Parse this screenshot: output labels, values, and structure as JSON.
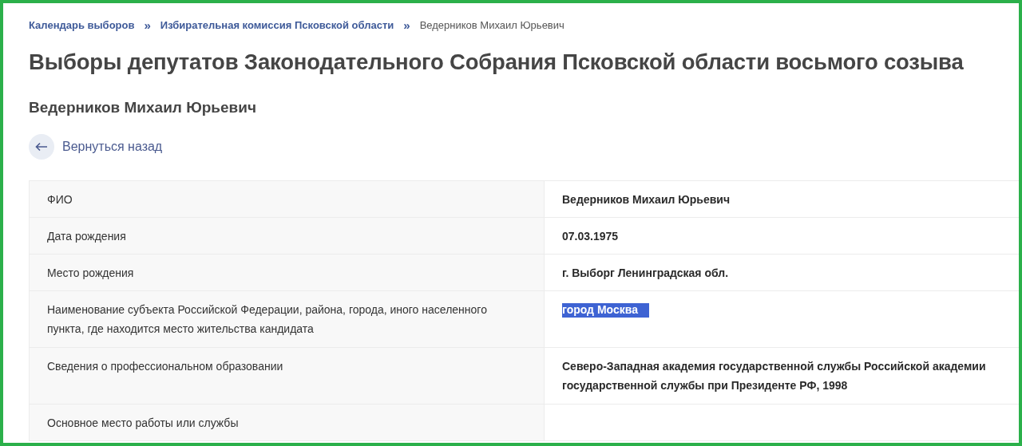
{
  "breadcrumbs": [
    {
      "label": "Календарь выборов",
      "kind": "link",
      "separator": "»"
    },
    {
      "label": "Избирательная комиссия Псковской области",
      "kind": "link",
      "separator": "»"
    },
    {
      "label": "Ведерников Михаил Юрьевич",
      "kind": "current"
    }
  ],
  "title": "Выборы депутатов Законодательного Собрания Псковской области восьмого созыва",
  "subtitle": "Ведерников Михаил Юрьевич",
  "back_link": {
    "label": "Вернуться назад"
  },
  "table": {
    "rows": [
      {
        "label": "ФИО",
        "value": "Ведерников Михаил Юрьевич",
        "highlighted": false
      },
      {
        "label": "Дата рождения",
        "value": "07.03.1975",
        "highlighted": false
      },
      {
        "label": "Место рождения",
        "value": "г. Выборг Ленинградская обл.",
        "highlighted": false
      },
      {
        "label": "Наименование субъекта Российской Федерации, района, города, иного населенного пункта, где находится место жительства кандидата",
        "value": "город Москва",
        "highlighted": true
      },
      {
        "label": "Сведения о профессиональном образовании",
        "value": "Северо-Западная академия государственной службы Российской академии государственной службы при Президенте РФ, 1998",
        "highlighted": false
      },
      {
        "label": "Основное место работы или службы"
      }
    ]
  }
}
